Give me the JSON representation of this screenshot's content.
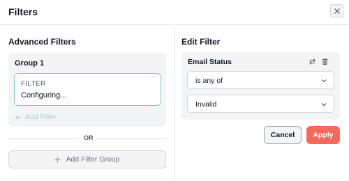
{
  "modal": {
    "title": "Filters"
  },
  "advanced": {
    "section_title": "Advanced Filters",
    "group": {
      "title": "Group 1",
      "filter_card": {
        "label": "FILTER",
        "value": "Configuring..."
      },
      "add_filter_label": "Add Filter"
    },
    "or_label": "OR",
    "add_group_label": "Add Filter Group"
  },
  "edit": {
    "section_title": "Edit Filter",
    "field_title": "Email Status",
    "operator_value": "is any of",
    "value_value": "Invalid"
  },
  "actions": {
    "cancel_label": "Cancel",
    "apply_label": "Apply"
  },
  "colors": {
    "accent_teal": "#7fc6c4",
    "apply_red": "#f26a5b"
  },
  "icons": {
    "close": "close-icon",
    "add": "plus-icon",
    "swap": "swap-icon",
    "delete": "trash-icon",
    "dropdown": "chevron-down-icon"
  }
}
